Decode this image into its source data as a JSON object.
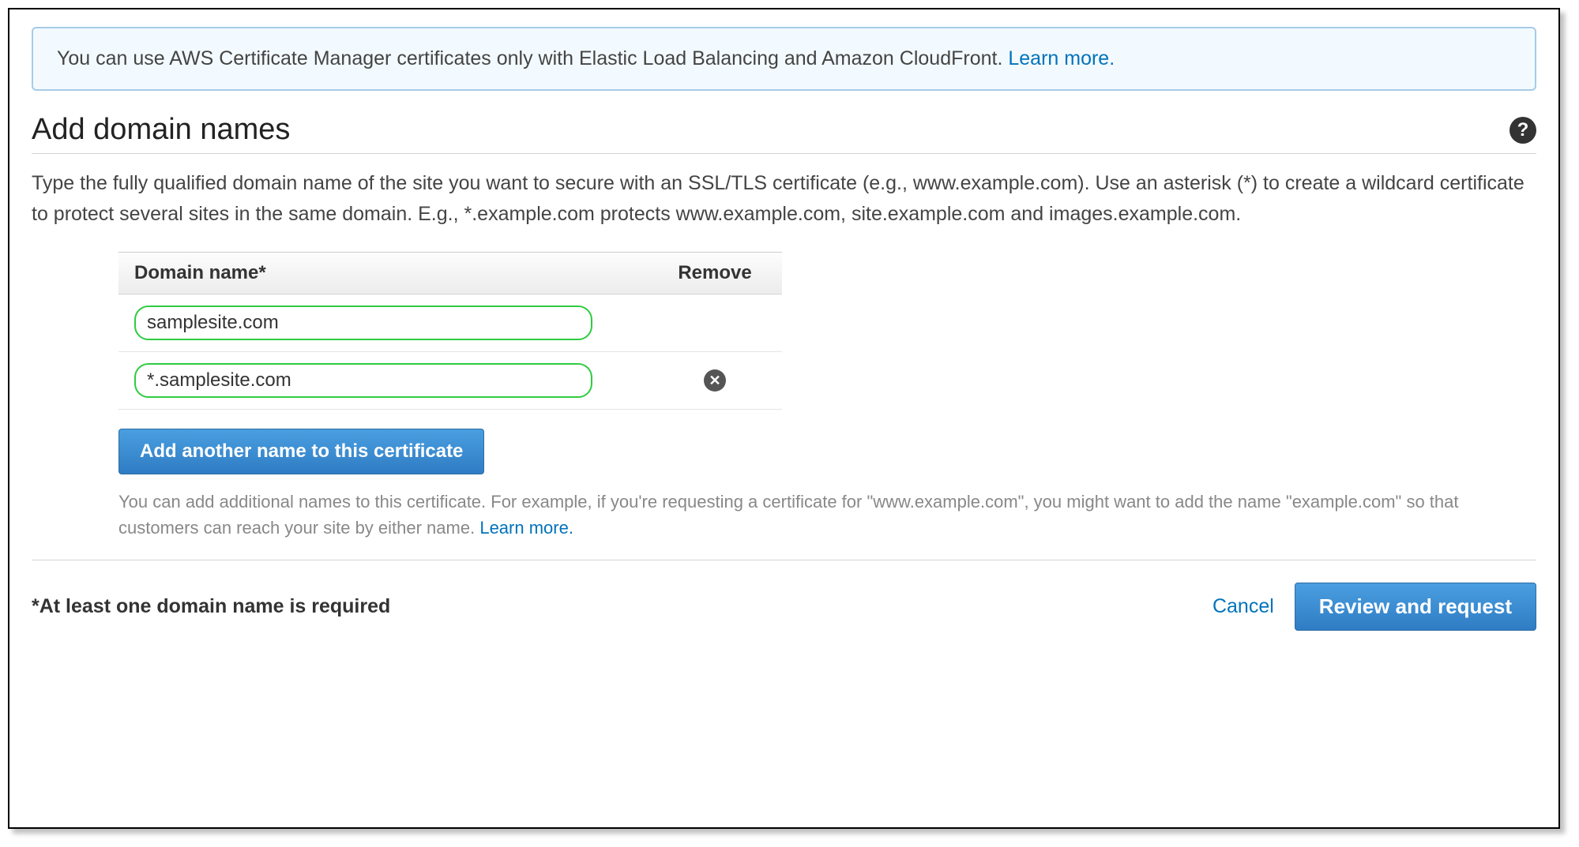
{
  "banner": {
    "text": "You can use AWS Certificate Manager certificates only with Elastic Load Balancing and Amazon CloudFront. ",
    "link": "Learn more."
  },
  "title": "Add domain names",
  "description": "Type the fully qualified domain name of the site you want to secure with an SSL/TLS certificate (e.g., www.example.com). Use an asterisk (*) to create a wildcard certificate to protect several sites in the same domain. E.g., *.example.com protects www.example.com, site.example.com and images.example.com.",
  "table": {
    "header_domain": "Domain name*",
    "header_remove": "Remove",
    "rows": [
      {
        "value": "samplesite.com",
        "removable": false
      },
      {
        "value": "*.samplesite.com",
        "removable": true
      }
    ]
  },
  "add_button": "Add another name to this certificate",
  "add_hint_text": "You can add additional names to this certificate. For example, if you're requesting a certificate for \"www.example.com\", you might want to add the name \"example.com\" so that customers can reach your site by either name. ",
  "add_hint_link": "Learn more.",
  "required_note": "*At least one domain name is required",
  "footer": {
    "cancel": "Cancel",
    "submit": "Review and request"
  }
}
